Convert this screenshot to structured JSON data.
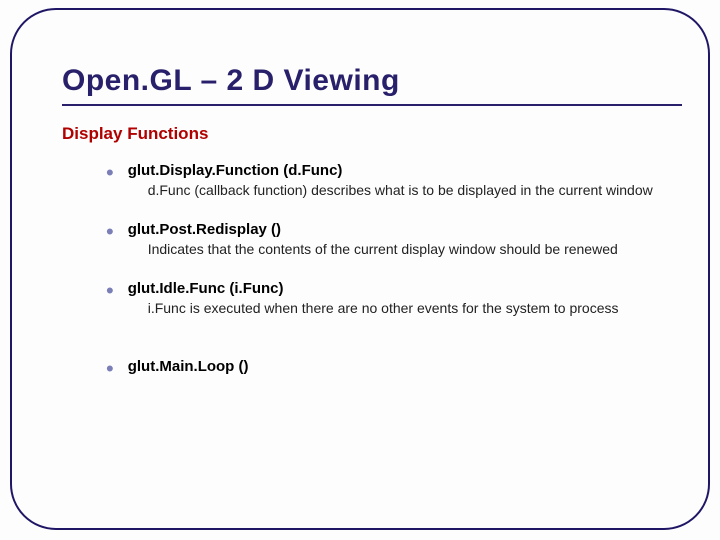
{
  "title": "Open.GL – 2 D Viewing",
  "section": "Display Functions",
  "items": [
    {
      "name": "glut.Display.Function (d.Func)",
      "desc": "d.Func (callback function) describes what is to be displayed in the current window"
    },
    {
      "name": "glut.Post.Redisplay ()",
      "desc": "Indicates that the contents of the current display window should be renewed"
    },
    {
      "name": "glut.Idle.Func (i.Func)",
      "desc": "i.Func is executed when there are no other events for the system to process"
    },
    {
      "name": "glut.Main.Loop ()",
      "desc": ""
    }
  ]
}
